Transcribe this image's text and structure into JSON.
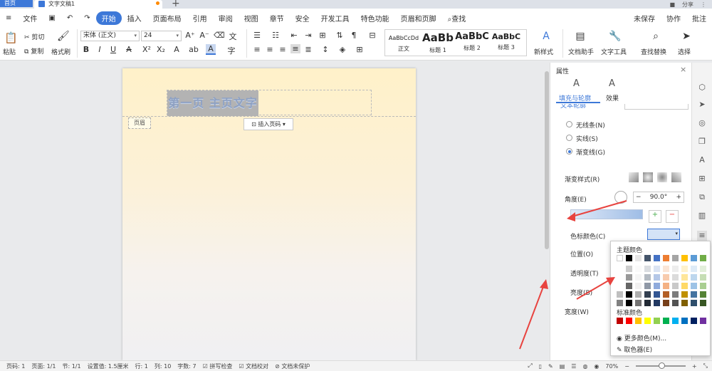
{
  "tabs": {
    "home": "首页",
    "doc": "文字文稿1",
    "plus": "+"
  },
  "topright": {
    "share": "分享",
    "more": "⋮"
  },
  "menu": {
    "file": "文件",
    "items": [
      "开始",
      "插入",
      "页面布局",
      "引用",
      "审阅",
      "视图",
      "章节",
      "安全",
      "开发工具",
      "特色功能",
      "页眉和页脚"
    ],
    "search": "查找",
    "unsaved": "未保存",
    "collab": "协作",
    "annotate": "批注"
  },
  "ribbon": {
    "paste": "粘贴",
    "cut": "剪切",
    "copy": "复制",
    "format_painter": "格式刷",
    "font": "宋体 (正文)",
    "size": "24",
    "styles": [
      {
        "sample": "AaBbCcDd",
        "label": "正文"
      },
      {
        "sample": "AaBb",
        "label": "标题 1"
      },
      {
        "sample": "AaBbC",
        "label": "标题 2"
      },
      {
        "sample": "AaBbC",
        "label": "标题 3"
      }
    ],
    "new_style": "新样式",
    "assistant": "文档助手",
    "text_tools": "文字工具",
    "find_replace": "查找替换",
    "select": "选择"
  },
  "document": {
    "header_text": "第一页 主页文字",
    "header_label": "页眉",
    "insert_page_num": "插入页码"
  },
  "panel": {
    "title": "属性",
    "tab_fill": "填充与轮廓",
    "tab_effect": "效果",
    "text_outline": "文本轮廓",
    "no_line": "无线条(N)",
    "solid_line": "实线(S)",
    "gradient_line": "渐变线(G)",
    "gradient_style": "渐变样式(R)",
    "angle": "角度(E)",
    "angle_value": "90.0°",
    "color_stop": "色标颜色(C)",
    "position": "位置(O)",
    "transparency": "透明度(T)",
    "brightness": "亮度(B)",
    "width": "宽度(W)"
  },
  "palette": {
    "theme_title": "主题颜色",
    "standard_title": "标准颜色",
    "more_colors": "更多颜色(M)...",
    "eyedropper": "取色器(E)",
    "theme_colors": [
      "#ffffff",
      "#000000",
      "#e7e6e6",
      "#44546a",
      "#4472c4",
      "#ed7d31",
      "#a5a5a5",
      "#ffc000",
      "#5b9bd5",
      "#70ad47"
    ],
    "standard_colors": [
      "#c00000",
      "#ff0000",
      "#ffc000",
      "#ffff00",
      "#92d050",
      "#00b050",
      "#00b0f0",
      "#0070c0",
      "#002060",
      "#7030a0"
    ]
  },
  "status": {
    "page": "页码: 1",
    "pages": "页面: 1/1",
    "section": "节: 1/1",
    "setting": "设置值: 1.5厘米",
    "row": "行: 1",
    "col": "列: 10",
    "words": "字数: 7",
    "spell": "拼写检查",
    "proof": "文档校对",
    "protect": "文档未保护",
    "zoom": "70%"
  },
  "colors": {
    "accent": "#3d78d8",
    "page_top": "#fff1c9",
    "arrow": "#e8433f"
  }
}
